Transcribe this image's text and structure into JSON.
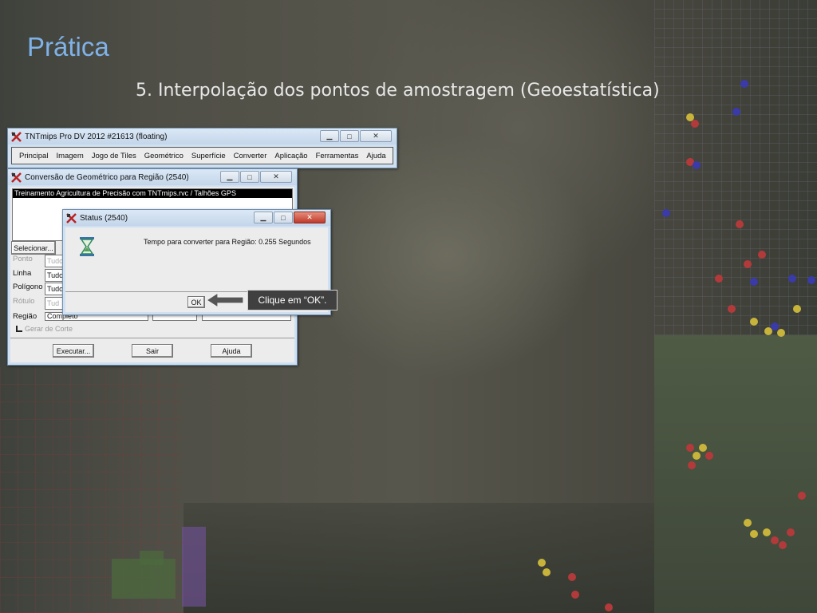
{
  "slide": {
    "title": "Prática",
    "subtitle": "5. Interpolação dos pontos de amostragem (Geoestatística)"
  },
  "main_window": {
    "title": "TNTmips Pro DV 2012  #21613 (floating)",
    "menu": [
      "Principal",
      "Imagem",
      "Jogo de Tiles",
      "Geométrico",
      "Superfície",
      "Converter",
      "Aplicação",
      "Ferramentas",
      "Ajuda"
    ]
  },
  "convert_window": {
    "title": "Conversão de Geométrico para Região (2540)",
    "selected_file": "Treinamento Agricultura de Precisão com TNTmips.rvc / Talhões GPS",
    "select_button": "Selecionar...",
    "rows": [
      {
        "label": "Ponto",
        "value": "Tudo",
        "enabled": false
      },
      {
        "label": "Linha",
        "value": "Tudo",
        "enabled": true
      },
      {
        "label": "Polígono",
        "value": "Tudo",
        "enabled": true
      },
      {
        "label": "Rótulo",
        "value": "Tud",
        "enabled": false
      },
      {
        "label": "Região",
        "value": "Completo",
        "enabled": true
      }
    ],
    "cut_checkbox_label": "Gerar  de Corte",
    "buttons": {
      "execute": "Executar...",
      "exit": "Sair",
      "help": "Ajuda"
    }
  },
  "status_window": {
    "title": "Status (2540)",
    "message": "Tempo para converter para Região: 0.255 Segundos",
    "ok_button": "OK",
    "icon": "hourglass-icon"
  },
  "callout": {
    "text": "Clique em “OK”."
  },
  "colors": {
    "title_accent": "#7fb2e8",
    "window_frame": "#cfe0f2",
    "close_red": "#c0392b"
  }
}
